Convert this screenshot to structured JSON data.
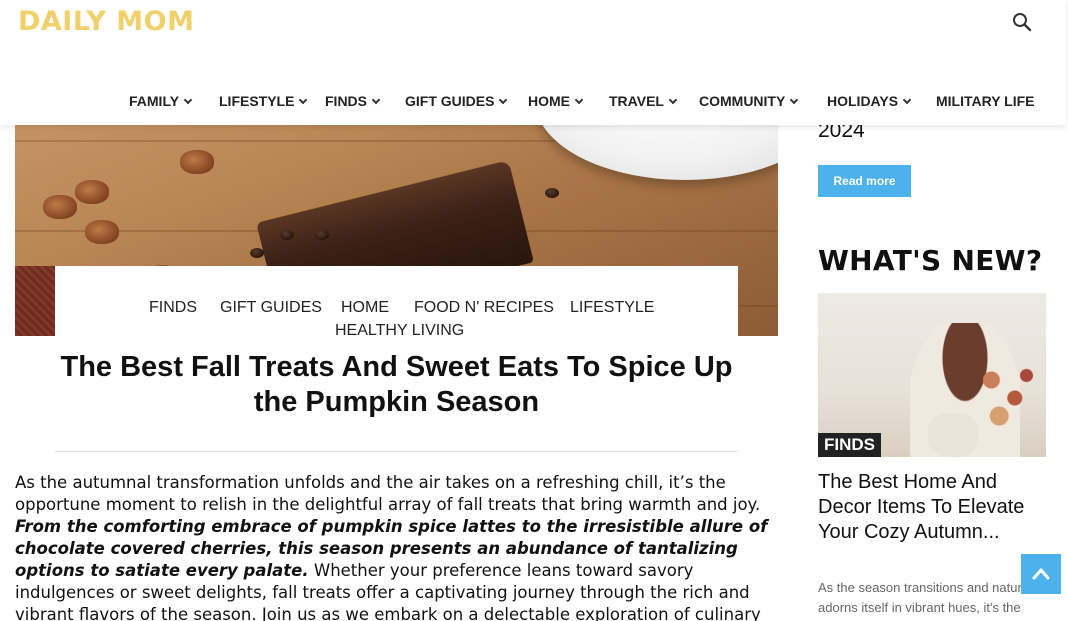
{
  "header": {
    "logo": "DAILY MOM",
    "search_icon": "search-icon"
  },
  "nav": {
    "items": [
      {
        "label": "FAMILY",
        "has_dropdown": true
      },
      {
        "label": "LIFESTYLE",
        "has_dropdown": true
      },
      {
        "label": "FINDS",
        "has_dropdown": true
      },
      {
        "label": "GIFT GUIDES",
        "has_dropdown": true
      },
      {
        "label": "HOME",
        "has_dropdown": true
      },
      {
        "label": "TRAVEL",
        "has_dropdown": true
      },
      {
        "label": "COMMUNITY",
        "has_dropdown": true
      },
      {
        "label": "HOLIDAYS",
        "has_dropdown": true
      },
      {
        "label": "MILITARY LIFE",
        "has_dropdown": false
      }
    ]
  },
  "post": {
    "categories": [
      "FINDS",
      "GIFT GUIDES",
      "HOME",
      "FOOD N' RECIPES",
      "LIFESTYLE",
      "HEALTHY LIVING"
    ],
    "title": "The Best Fall Treats And Sweet Eats To Spice Up the Pumpkin Season",
    "intro": "As the autumnal transformation unfolds and the air takes on a refreshing chill, it’s the opportune moment to relish in the delightful array of fall treats that bring warmth and joy.",
    "bold": "From the comforting embrace of pumpkin spice lattes to the irresistible allure of chocolate covered cherries, this season presents an abundance of tantalizing options to satiate every palate.",
    "rest": "Whether your preference leans toward savory indulgences or sweet delights, fall treats offer a captivating journey through the rich and vibrant flavors of the season. Join us as we embark on a delectable exploration of culinary wonders with a fall"
  },
  "sidebar": {
    "prev_title_tail": "2024",
    "read_more": "Read more",
    "whats_new": "WHAT'S NEW?",
    "card": {
      "tag": "FINDS",
      "title": "The Best Home And Decor Items To Elevate Your Cozy Autumn...",
      "excerpt": "As the season transitions and nature adorns itself in vibrant hues, it's the"
    }
  },
  "colors": {
    "accent": "#4db2ec",
    "logo": "#f1d06a"
  },
  "back_to_top_icon": "arrow-up-icon"
}
